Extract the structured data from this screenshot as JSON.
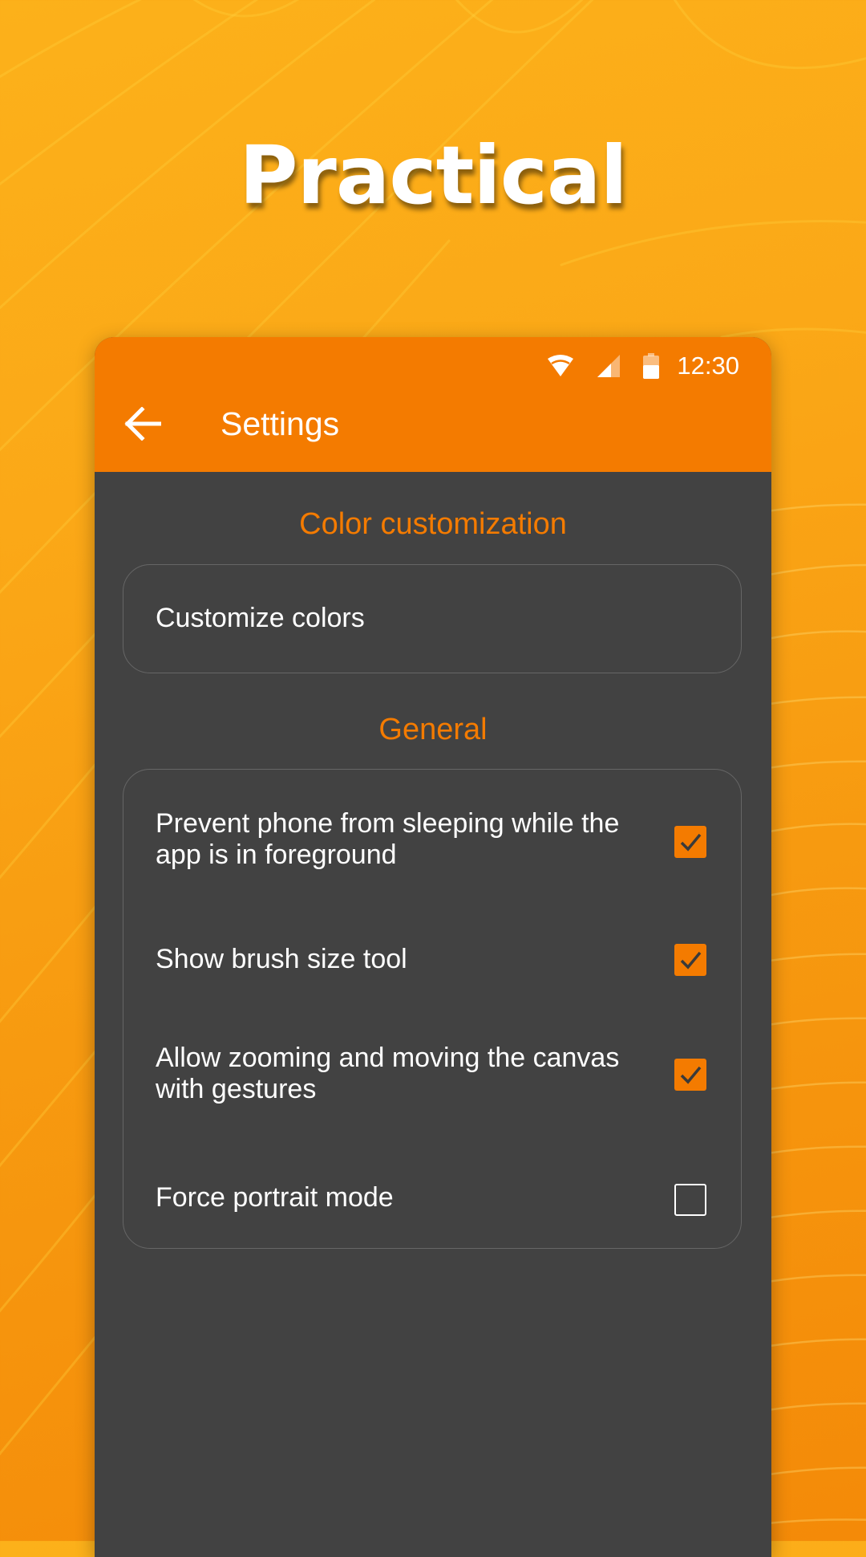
{
  "headline": "Practical",
  "status_bar": {
    "time": "12:30",
    "icons": [
      "wifi-icon",
      "cell-signal-icon",
      "battery-icon"
    ]
  },
  "appbar": {
    "back_icon": "arrow-left-icon",
    "title": "Settings"
  },
  "sections": {
    "color_customization": {
      "header": "Color customization",
      "items": [
        {
          "label": "Customize colors"
        }
      ]
    },
    "general": {
      "header": "General",
      "items": [
        {
          "label": "Prevent phone from sleeping while the app is in foreground",
          "checked": true
        },
        {
          "label": "Show brush size tool",
          "checked": true
        },
        {
          "label": "Allow zooming and moving the canvas with gestures",
          "checked": true
        },
        {
          "label": "Force portrait mode",
          "checked": false
        }
      ]
    }
  },
  "colors": {
    "accent": "#f47b00",
    "surface": "#424242",
    "background": "#fba817",
    "text": "#ffffff",
    "card_border": "#666666"
  }
}
